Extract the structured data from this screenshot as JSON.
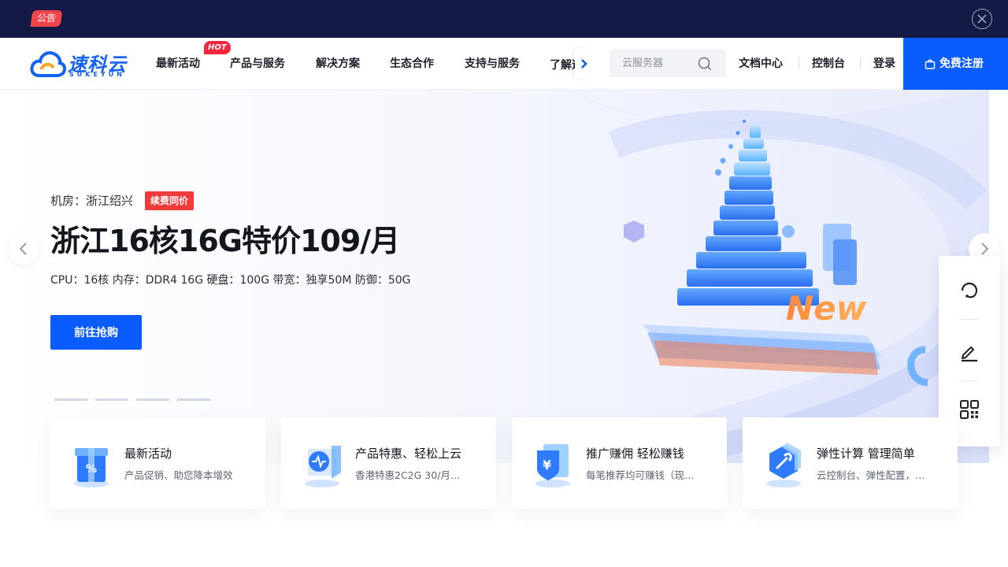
{
  "notice": {
    "badge": "公告"
  },
  "logo": {
    "name": "速科云",
    "sub": "SUKEYUN"
  },
  "nav": {
    "items": [
      {
        "label": "最新活动"
      },
      {
        "label": "产品与服务"
      },
      {
        "label": "解决方案"
      },
      {
        "label": "生态合作"
      },
      {
        "label": "支持与服务"
      },
      {
        "label": "了解速科云"
      }
    ],
    "hot_badge": "HOT"
  },
  "search": {
    "placeholder": "云服务器"
  },
  "header_links": [
    {
      "label": "文档中心"
    },
    {
      "label": "控制台"
    },
    {
      "label": "登录"
    }
  ],
  "register": {
    "label": "免费注册"
  },
  "hero": {
    "location": "机房：浙江绍兴",
    "tag": "续费同价",
    "title": "浙江16核16G特价109/月",
    "specs": "CPU：16核 内存：DDR4 16G 硬盘：100G 带宽：独享50M 防御：50G",
    "cta": "前往抢购",
    "art_word": "New"
  },
  "cards": [
    {
      "title": "最新活动",
      "desc": "产品促销、助您降本增效"
    },
    {
      "title": "产品特惠、轻松上云",
      "desc": "香港特惠2C2G 30/月…"
    },
    {
      "title": "推广赚佣 轻松赚钱",
      "desc": "每笔推荐均可赚钱（现…"
    },
    {
      "title": "弹性计算 管理简单",
      "desc": "云控制台、弹性配置，…"
    }
  ],
  "colors": {
    "primary": "#0b5cff",
    "notice_bg": "#141a45",
    "hot": "#f3263c",
    "tag_red": "#f03b3b"
  }
}
